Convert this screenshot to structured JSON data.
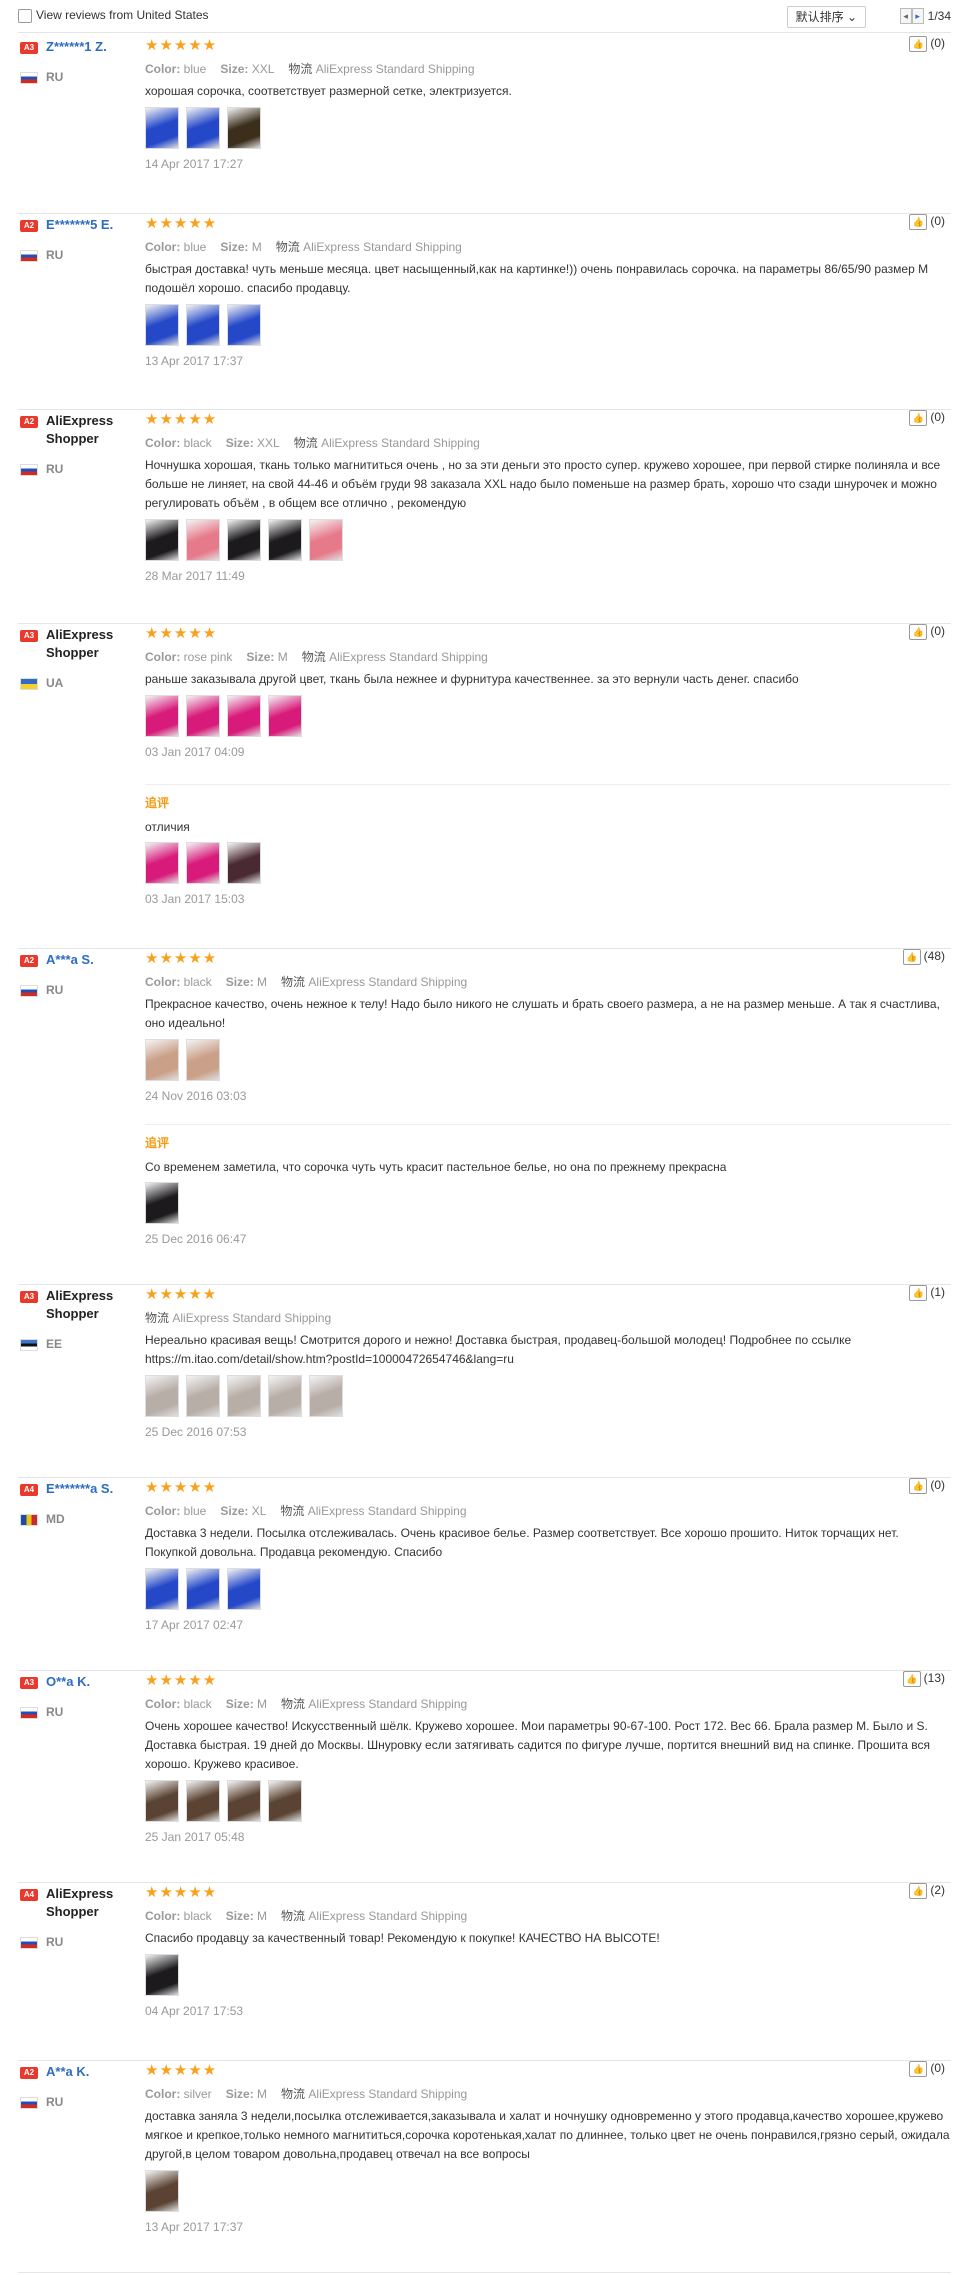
{
  "toolbar": {
    "filter_label": "View reviews from United States",
    "sort_label": "默认排序",
    "page_indicator": "1/34"
  },
  "labels": {
    "color": "Color:",
    "size": "Size:",
    "shipping_prefix": "物流"
  },
  "reviews": [
    {
      "level": "A3",
      "name": "Z******1 Z.",
      "country": "RU",
      "color": "blue",
      "size": "XXL",
      "shipping": "AliExpress Standard Shipping",
      "text": "хорошая сорочка, соответствует размерной сетке, электризуется.",
      "photos": [
        "blue",
        "blue",
        "blackgold"
      ],
      "date": "14 Apr 2017 17:27",
      "likes": "(0)"
    },
    {
      "level": "A2",
      "name": "E*******5 E.",
      "country": "RU",
      "color": "blue",
      "size": "M",
      "shipping": "AliExpress Standard Shipping",
      "text": "быстрая доставка! чуть меньше месяца. цвет насыщенный,как на картинке!)) очень понравилась сорочка. на параметры 86/65/90 размер М подошёл хорошо. спасибо продавцу.",
      "photos": [
        "blue",
        "blue",
        "blue"
      ],
      "date": "13 Apr 2017 17:37",
      "likes": "(0)"
    },
    {
      "level": "A2",
      "name": "AliExpress Shopper",
      "country": "RU",
      "color": "black",
      "size": "XXL",
      "shipping": "AliExpress Standard Shipping",
      "text": "Ночнушка хорошая, ткань только магнититься очень , но за эти деньги это просто супер. кружево хорошее, при первой стирке полиняла и все больше не линяет, на свой 44-46 и объём груди 98 заказала XXL надо было поменьше на размер брать, хорошо что сзади шнурочек и можно регулировать объём , в общем все отлично , рекомендую",
      "photos": [
        "black",
        "blackpink",
        "black",
        "black",
        "blackpink"
      ],
      "date": "28 Mar 2017 11:49",
      "likes": "(0)"
    },
    {
      "level": "A3",
      "name": "AliExpress Shopper",
      "country": "UA",
      "color": "rose pink",
      "size": "M",
      "shipping": "AliExpress Standard Shipping",
      "text": "раньше заказывала другой цвет, ткань была нежнее и фурнитура качественнее. за это вернули часть денег. спасибо",
      "photos": [
        "pink",
        "pink",
        "pink",
        "pink"
      ],
      "date": "03 Jan 2017 04:09",
      "likes": "(0)",
      "additional": {
        "label": "追评",
        "text": "отличия",
        "photos": [
          "pink",
          "pink",
          "pinkdark"
        ],
        "date": "03 Jan 2017 15:03"
      }
    },
    {
      "level": "A2",
      "name": "A***a S.",
      "country": "RU",
      "color": "black",
      "size": "M",
      "shipping": "AliExpress Standard Shipping",
      "text": "Прекрасное качество, очень нежное к телу! Надо было никого не слушать и брать своего размера, а не на размер меньше. А так я счастлива, оно идеально!",
      "photos": [
        "skin",
        "skin"
      ],
      "date": "24 Nov 2016 03:03",
      "likes": "(48)",
      "additional": {
        "label": "追评",
        "text": "Со временем заметила, что сорочка чуть чуть красит пастельное белье, но она по прежнему прекрасна",
        "photos": [
          "black"
        ],
        "date": "25 Dec 2016 06:47"
      }
    },
    {
      "level": "A3",
      "name": "AliExpress Shopper",
      "country": "EE",
      "color": "",
      "size": "",
      "shipping": "AliExpress Standard Shipping",
      "text": "Нереально красивая вещь! Смотрится дорого и нежно! Доставка быстрая, продавец-большой молодец! Подробнее по ссылке https://m.itao.com/detail/show.htm?postId=10000472654746&lang=ru",
      "photos": [
        "grey",
        "grey",
        "grey",
        "grey",
        "grey"
      ],
      "date": "25 Dec 2016 07:53",
      "likes": "(1)"
    },
    {
      "level": "A4",
      "name": "E*******a S.",
      "country": "MD",
      "color": "blue",
      "size": "XL",
      "shipping": "AliExpress Standard Shipping",
      "text": "Доставка 3 недели. Посылка отслеживалась. Очень красивое белье. Размер соответствует. Все хорошо прошито. Ниток торчащих нет. Покупкой довольна. Продавца рекомендую. Спасибо",
      "photos": [
        "blue",
        "blue",
        "blue"
      ],
      "date": "17 Apr 2017 02:47",
      "likes": "(0)"
    },
    {
      "level": "A3",
      "name": "O**a K.",
      "country": "RU",
      "color": "black",
      "size": "M",
      "shipping": "AliExpress Standard Shipping",
      "text": "Очень хорошее качество! Искусственный шёлк. Кружево хорошее. Мои параметры 90-67-100. Рост 172. Вес 66. Брала размер М. Было и S. Доставка быстрая. 19 дней до Москвы. Шнуровку если затягивать садится по фигуре лучше, портится внешний вид на спинке. Прошита вся хорошо. Кружево красивое.",
      "photos": [
        "brown",
        "brown",
        "brown",
        "brown"
      ],
      "date": "25 Jan 2017 05:48",
      "likes": "(13)"
    },
    {
      "level": "A4",
      "name": "AliExpress Shopper",
      "country": "RU",
      "color": "black",
      "size": "M",
      "shipping": "AliExpress Standard Shipping",
      "text": "Спасибо продавцу за качественный товар! Рекомендую к покупке! КАЧЕСТВО НА ВЫСОТЕ!",
      "photos": [
        "black"
      ],
      "date": "04 Apr 2017 17:53",
      "likes": "(2)"
    },
    {
      "level": "A2",
      "name": "A**a K.",
      "country": "RU",
      "color": "silver",
      "size": "M",
      "shipping": "AliExpress Standard Shipping",
      "text": "доставка заняла 3 недели,посылка отслеживается,заказывала и халат и ночнушку одновременно у этого продавца,качество хорошее,кружево мягкое и крепкое,только немного магнититься,сорочка коротенькая,халат по длиннее, только цвет не очень понравился,грязно серый, ожидала другой,в целом товаром довольна,продавец отвечал на все вопросы",
      "photos": [
        "brown"
      ],
      "date": "13 Apr 2017 17:37",
      "likes": "(0)"
    }
  ],
  "colors": {
    "level_badge": "#e8392c",
    "star": "#f8a11e",
    "link": "#2d6cc0",
    "additional": "#f39c12",
    "photo": {
      "blue": "#2448c8",
      "blackgold": "#3b2f1c",
      "black": "#1c1a1d",
      "blackpink": "#e77a8a",
      "pink": "#d81b7a",
      "pinkdark": "#4a2a32",
      "skin": "#caa088",
      "grey": "#b8aea8",
      "brown": "#5a4332"
    }
  }
}
